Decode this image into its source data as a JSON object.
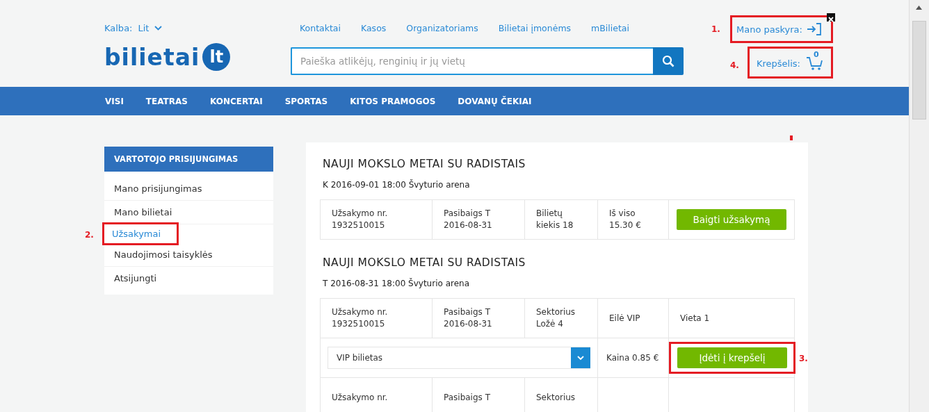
{
  "header": {
    "language_label": "Kalba:",
    "language": "Lit",
    "top_links": [
      "Kontaktai",
      "Kasos",
      "Organizatoriams",
      "Bilietai įmonėms",
      "mBilietai"
    ],
    "logo_text": "bilietai",
    "logo_badge": "lt",
    "search": {
      "placeholder": "Paieška atlikėjų, renginių ir jų vietų"
    },
    "account": {
      "label": "Mano paskyra:",
      "annotation": "1."
    },
    "cart": {
      "label": "Krepšelis:",
      "count": "0",
      "annotation": "4."
    }
  },
  "nav": {
    "items": [
      "VISI",
      "TEATRAS",
      "KONCERTAI",
      "SPORTAS",
      "KITOS PRAMOGOS",
      "DOVANŲ ČEKIAI"
    ]
  },
  "sidebar": {
    "title": "VARTOTOJO PRISIJUNGIMAS",
    "items": [
      {
        "label": "Mano prisijungimas",
        "selected": false
      },
      {
        "label": "Mano bilietai",
        "selected": false
      },
      {
        "label": "Užsakymai",
        "selected": true,
        "annotation": "2."
      },
      {
        "label": "Naudojimosi taisyklės",
        "selected": false
      },
      {
        "label": "Atsijungti",
        "selected": false
      }
    ]
  },
  "orders": [
    {
      "title": "NAUJI MOKSLO METAI SU RADISTAIS",
      "subtitle": "K 2016-09-01 18:00 Švyturio arena",
      "rows": [
        {
          "kind": "info",
          "cells": [
            {
              "label": "Užsakymo nr.",
              "value": "1932510015"
            },
            {
              "label": "Pasibaigs T",
              "value": "2016-08-31"
            },
            {
              "label": "Bilietų",
              "value": "kiekis 18"
            },
            {
              "label": "Iš viso",
              "value": "15.30 €"
            }
          ],
          "button": "Baigti užsakymą"
        }
      ]
    },
    {
      "title": "NAUJI MOKSLO METAI SU RADISTAIS",
      "subtitle": "T 2016-08-31 18:00 Švyturio arena",
      "rows": [
        {
          "kind": "info",
          "cells": [
            {
              "label": "Užsakymo nr.",
              "value": "1932510015"
            },
            {
              "label": "Pasibaigs T",
              "value": "2016-08-31"
            },
            {
              "label": "Sektorius",
              "value": "Ložė 4"
            },
            {
              "label": "Eilė VIP"
            },
            {
              "label": "Vieta 1"
            }
          ]
        },
        {
          "kind": "purchase",
          "select": "VIP bilietas",
          "price": "Kaina 0.85 €",
          "button": "Įdėti į krepšelį",
          "annotation": "3."
        },
        {
          "kind": "info",
          "cells": [
            {
              "label": "Užsakymo nr."
            },
            {
              "label": "Pasibaigs T"
            },
            {
              "label": "Sektorius"
            },
            {},
            {}
          ]
        }
      ]
    }
  ]
}
